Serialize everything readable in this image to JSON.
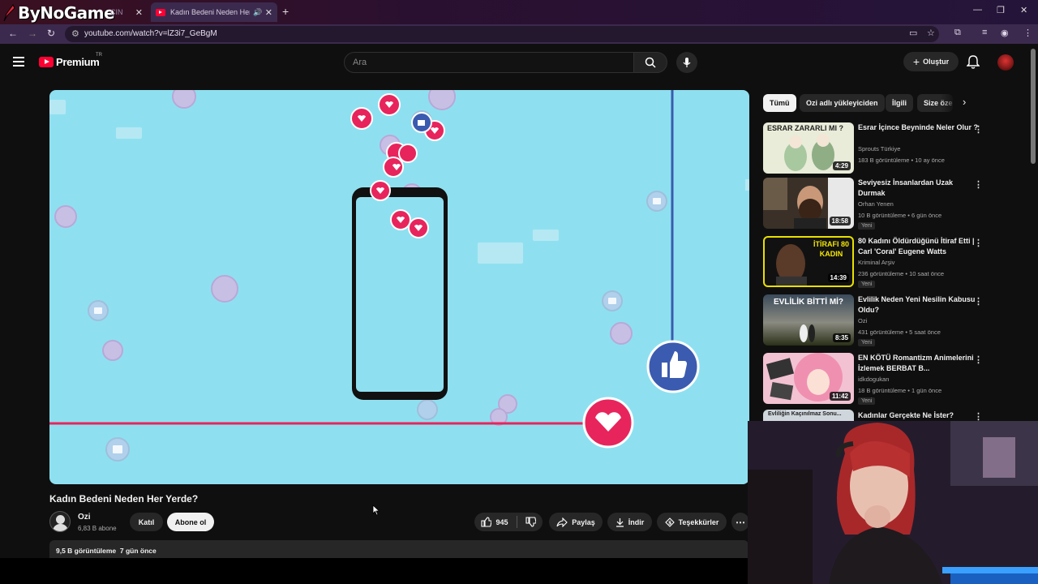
{
  "overlay": {
    "brand": "ByNoGame"
  },
  "browser": {
    "tabs": [
      {
        "label": "ÇIN"
      },
      {
        "label": "Kadın Bedeni Neden Her Yerde?"
      }
    ],
    "url": "youtube.com/watch?v=lZ3i7_GeBgM"
  },
  "youtube": {
    "logo": "Premium",
    "country_code": "TR",
    "search_placeholder": "Ara",
    "create_label": "Oluştur"
  },
  "video": {
    "title": "Kadın Bedeni Neden Her Yerde?",
    "channel": "Ozi",
    "subscribers": "6,83 B abone",
    "join_label": "Katıl",
    "subscribe_label": "Abone ol",
    "likes": "945",
    "share_label": "Paylaş",
    "download_label": "İndir",
    "thanks_label": "Teşekkürler",
    "views": "9,5 B görüntüleme",
    "date": "7 gün önce"
  },
  "chips": [
    "Tümü",
    "Ozi adlı yükleyiciden",
    "İlgili",
    "Size özel"
  ],
  "recommendations": [
    {
      "title": "Esrar İçince Beyninde Neler Olur ?",
      "channel": "Sprouts Türkiye",
      "meta": "183 B görüntüleme • 10 ay önce",
      "duration": "4:29",
      "badge": "",
      "thumb_text": "ESRAR ZARARLI MI ?"
    },
    {
      "title": "Seviyesiz İnsanlardan Uzak Durmak",
      "channel": "Orhan Yenen",
      "meta": "10 B görüntüleme • 6 gün önce",
      "duration": "18:58",
      "badge": "Yeni",
      "thumb_text": ""
    },
    {
      "title": "80 Kadını Öldürdüğünü İtiraf Etti | Carl 'Coral' Eugene Watts",
      "channel": "Kriminal Arşiv",
      "meta": "236 görüntüleme • 10 saat önce",
      "duration": "14:39",
      "badge": "Yeni",
      "thumb_text": "İTİRAFI 80 KADIN"
    },
    {
      "title": "Evlilik Neden Yeni Nesilin Kabusu Oldu?",
      "channel": "Ozi",
      "meta": "431 görüntüleme • 5 saat önce",
      "duration": "8:35",
      "badge": "Yeni",
      "thumb_text": "EVLİLİK BİTTİ Mİ?"
    },
    {
      "title": "EN KÖTÜ Romantizm Animelerini İzlemek BERBAT B...",
      "channel": "idkdogukan",
      "meta": "18 B görüntüleme • 1 gün önce",
      "duration": "11:42",
      "badge": "Yeni",
      "thumb_text": ""
    },
    {
      "title": "Kadınlar Gerçekte Ne İster?",
      "thumb_text": "Evliliğin Kaçınılmaz Sonu..."
    }
  ],
  "colors": {
    "accent_red": "#ff0033",
    "video_bg": "#8ee0f0",
    "heart_pink": "#e8245c",
    "like_blue": "#3b5bb0"
  }
}
